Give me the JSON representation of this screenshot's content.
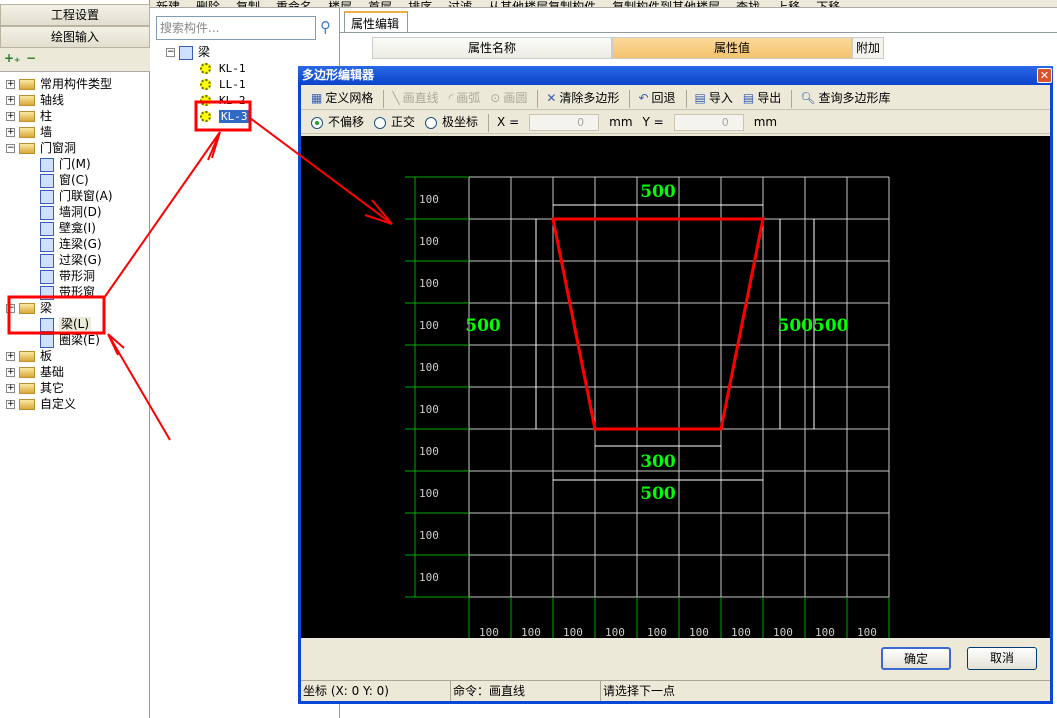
{
  "top_toolbar": {
    "items": [
      "新建",
      "删除",
      "复制",
      "重命名",
      "楼层",
      "首层",
      "排序",
      "过滤",
      "从其他楼层复制构件",
      "复制构件到其他楼层",
      "查找",
      "上移",
      "下移"
    ]
  },
  "left": {
    "nav": [
      "工程设置",
      "绘图输入"
    ],
    "tree": [
      {
        "label": "常用构件类型",
        "expand": "+",
        "indent": 0,
        "icon": "folder-icon"
      },
      {
        "label": "轴线",
        "expand": "+",
        "indent": 0,
        "icon": "folder-icon"
      },
      {
        "label": "柱",
        "expand": "+",
        "indent": 0,
        "icon": "folder-icon"
      },
      {
        "label": "墙",
        "expand": "+",
        "indent": 0,
        "icon": "folder-icon"
      },
      {
        "label": "门窗洞",
        "expand": "-",
        "indent": 0,
        "icon": "folder-open-icon"
      },
      {
        "label": "门(M)",
        "indent": 1,
        "icon": "door-icon"
      },
      {
        "label": "窗(C)",
        "indent": 1,
        "icon": "window-icon"
      },
      {
        "label": "门联窗(A)",
        "indent": 1,
        "icon": "door-window-icon"
      },
      {
        "label": "墙洞(D)",
        "indent": 1,
        "icon": "wall-hole-icon"
      },
      {
        "label": "壁龛(I)",
        "indent": 1,
        "icon": "niche-icon"
      },
      {
        "label": "连梁(G)",
        "indent": 1,
        "icon": "coupling-beam-icon"
      },
      {
        "label": "过梁(G)",
        "indent": 1,
        "icon": "lintel-icon"
      },
      {
        "label": "带形洞",
        "indent": 1,
        "icon": "strip-hole-icon"
      },
      {
        "label": "带形窗",
        "indent": 1,
        "icon": "strip-window-icon"
      },
      {
        "label": "梁",
        "expand": "-",
        "indent": 0,
        "icon": "folder-open-icon"
      },
      {
        "label": "梁(L)",
        "indent": 1,
        "icon": "beam-icon",
        "selected": true
      },
      {
        "label": "圈梁(E)",
        "indent": 1,
        "icon": "ring-beam-icon"
      },
      {
        "label": "板",
        "expand": "+",
        "indent": 0,
        "icon": "folder-icon"
      },
      {
        "label": "基础",
        "expand": "+",
        "indent": 0,
        "icon": "folder-icon"
      },
      {
        "label": "其它",
        "expand": "+",
        "indent": 0,
        "icon": "folder-icon"
      },
      {
        "label": "自定义",
        "expand": "+",
        "indent": 0,
        "icon": "folder-icon"
      }
    ]
  },
  "mid": {
    "search_placeholder": "搜索构件...",
    "root": "梁",
    "items": [
      "KL-1",
      "LL-1",
      "KL-2",
      "KL-3"
    ],
    "selected": "KL-3"
  },
  "props": {
    "tab": "属性编辑",
    "columns": [
      "属性名称",
      "属性值",
      "附加"
    ]
  },
  "dialog": {
    "title": "多边形编辑器",
    "toolbar": [
      {
        "label": "定义网格",
        "enabled": true,
        "icon": "grid-icon"
      },
      {
        "label": "画直线",
        "enabled": false,
        "icon": "line-icon"
      },
      {
        "label": "画弧",
        "enabled": false,
        "icon": "arc-icon"
      },
      {
        "label": "画圆",
        "enabled": false,
        "icon": "circle-icon"
      },
      {
        "label": "清除多边形",
        "enabled": true,
        "icon": "clear-icon"
      },
      {
        "label": "回退",
        "enabled": true,
        "icon": "undo-icon"
      },
      {
        "label": "导入",
        "enabled": true,
        "icon": "import-icon"
      },
      {
        "label": "导出",
        "enabled": true,
        "icon": "export-icon"
      },
      {
        "label": "查询多边形库",
        "enabled": true,
        "icon": "search-icon"
      }
    ],
    "modes": [
      "不偏移",
      "正交",
      "极坐标"
    ],
    "selected_mode": "不偏移",
    "x_label": "X =",
    "x_value": "0",
    "y_label": "Y =",
    "y_value": "0",
    "unit": "mm",
    "grid": {
      "spacing": "100",
      "rows": 10,
      "cols": 10
    },
    "polygon_mm": [
      [
        100,
        0
      ],
      [
        600,
        0
      ],
      [
        500,
        500
      ],
      [
        200,
        500
      ]
    ],
    "dims": {
      "top": "500",
      "left": "500",
      "right": "500500",
      "bottom_inner": "300",
      "bottom_outer": "500"
    },
    "polygon_color": "#ff0000",
    "dim_text_color": "#00ff00",
    "ok": "确定",
    "cancel": "取消",
    "status": {
      "coord": "坐标 (X: 0 Y: 0)",
      "command": "命令：画直线",
      "hint": "请选择下一点"
    }
  }
}
